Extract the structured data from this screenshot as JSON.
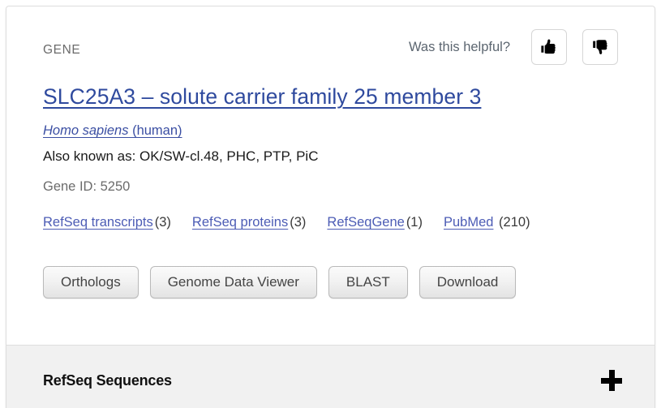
{
  "card": {
    "kicker": "GENE",
    "feedback": {
      "label": "Was this helpful?",
      "thumbs_up_icon": "thumbs-up-icon",
      "thumbs_down_icon": "thumbs-down-icon"
    },
    "title": "SLC25A3  –  solute carrier family 25 member 3",
    "organism": {
      "scientific_name": "Homo sapiens",
      "common_name": " (human)"
    },
    "also_known_as": "Also known as: OK/SW-cl.48, PHC, PTP, PiC",
    "gene_id": "Gene ID: 5250",
    "resource_links": [
      {
        "label": "RefSeq transcripts",
        "count": "(3)"
      },
      {
        "label": "RefSeq proteins",
        "count": "(3)"
      },
      {
        "label": "RefSeqGene",
        "count": "(1)"
      },
      {
        "label": "PubMed",
        "count": "(210)"
      }
    ],
    "buttons": [
      {
        "label": "Orthologs"
      },
      {
        "label": "Genome Data Viewer"
      },
      {
        "label": "BLAST"
      },
      {
        "label": "Download"
      }
    ]
  },
  "accordion": {
    "title": "RefSeq Sequences",
    "toggle_icon": "plus-icon"
  },
  "colors": {
    "title_link": "#2f4a9e",
    "body_link": "#4c5cb5",
    "muted_text": "#6b6b6b",
    "helpful_text": "#5c6670",
    "footer_bg": "#f1f1f1",
    "card_border": "#dedede"
  }
}
